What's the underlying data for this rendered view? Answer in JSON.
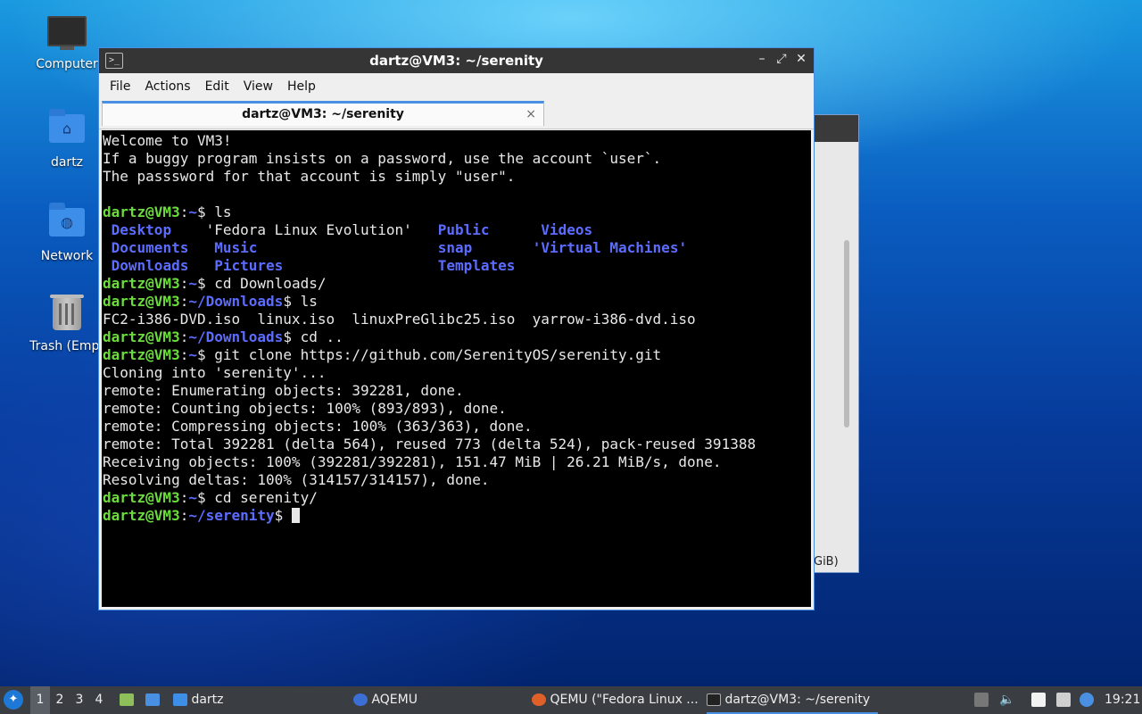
{
  "desktop": {
    "icons": [
      {
        "label": "Computer",
        "icon": "computer-icon"
      },
      {
        "label": "dartz",
        "icon": "home-folder-icon"
      },
      {
        "label": "Network",
        "icon": "network-folder-icon"
      },
      {
        "label": "Trash (Empt",
        "icon": "trash-icon"
      }
    ]
  },
  "background_window": {
    "partial_text": "GiB)"
  },
  "terminal": {
    "title": "dartz@VM3: ~/serenity",
    "menu": [
      "File",
      "Actions",
      "Edit",
      "View",
      "Help"
    ],
    "tab_label": "dartz@VM3: ~/serenity",
    "tab_close": "×",
    "controls": {
      "minimize": "–",
      "maximize": "⤢",
      "close": "✕"
    },
    "prompt_user": "dartz@VM3",
    "lines": {
      "welcome1": "Welcome to VM3!",
      "welcome2": "If a buggy program insists on a password, use the account `user`.",
      "welcome3": "The passsword for that account is simply \"user\".",
      "cmd_ls": "$ ls",
      "ls_row1_a": "Desktop",
      "ls_row1_b": "'Fedora Linux Evolution'",
      "ls_row1_c": "Public",
      "ls_row1_d": "Videos",
      "ls_row2_a": "Documents",
      "ls_row2_b": "Music",
      "ls_row2_c": "snap",
      "ls_row2_d": "'Virtual Machines'",
      "ls_row3_a": "Downloads",
      "ls_row3_b": "Pictures",
      "ls_row3_c": "Templates",
      "cmd_cd_downloads": "$ cd Downloads/",
      "path_home": "~",
      "path_downloads": "~/Downloads",
      "path_serenity": "~/serenity",
      "cmd_ls2": "$ ls",
      "iso_list": "FC2-i386-DVD.iso  linux.iso  linuxPreGlibc25.iso  yarrow-i386-dvd.iso",
      "cmd_cd_up": "$ cd ..",
      "cmd_clone": "$ git clone https://github.com/SerenityOS/serenity.git",
      "clone1": "Cloning into 'serenity'...",
      "clone2": "remote: Enumerating objects: 392281, done.",
      "clone3": "remote: Counting objects: 100% (893/893), done.",
      "clone4": "remote: Compressing objects: 100% (363/363), done.",
      "clone5": "remote: Total 392281 (delta 564), reused 773 (delta 524), pack-reused 391388",
      "clone6": "Receiving objects: 100% (392281/392281), 151.47 MiB | 26.21 MiB/s, done.",
      "clone7": "Resolving deltas: 100% (314157/314157), done.",
      "cmd_cd_serenity": "$ cd serenity/",
      "final_prompt_tail": "$ "
    }
  },
  "taskbar": {
    "workspaces": [
      "1",
      "2",
      "3",
      "4"
    ],
    "tasks": [
      {
        "label": "dartz",
        "icon": "folder-icon"
      },
      {
        "label": "AQEMU",
        "icon": "aqemu-icon"
      },
      {
        "label": "QEMU (\"Fedora Linux ...",
        "icon": "qemu-icon"
      },
      {
        "label": "dartz@VM3: ~/serenity",
        "icon": "terminal-icon"
      }
    ],
    "clock": "19:21"
  },
  "colors": {
    "prompt_green": "#6bdc3c",
    "dir_blue": "#5c6cff",
    "accent": "#4a90e2"
  }
}
